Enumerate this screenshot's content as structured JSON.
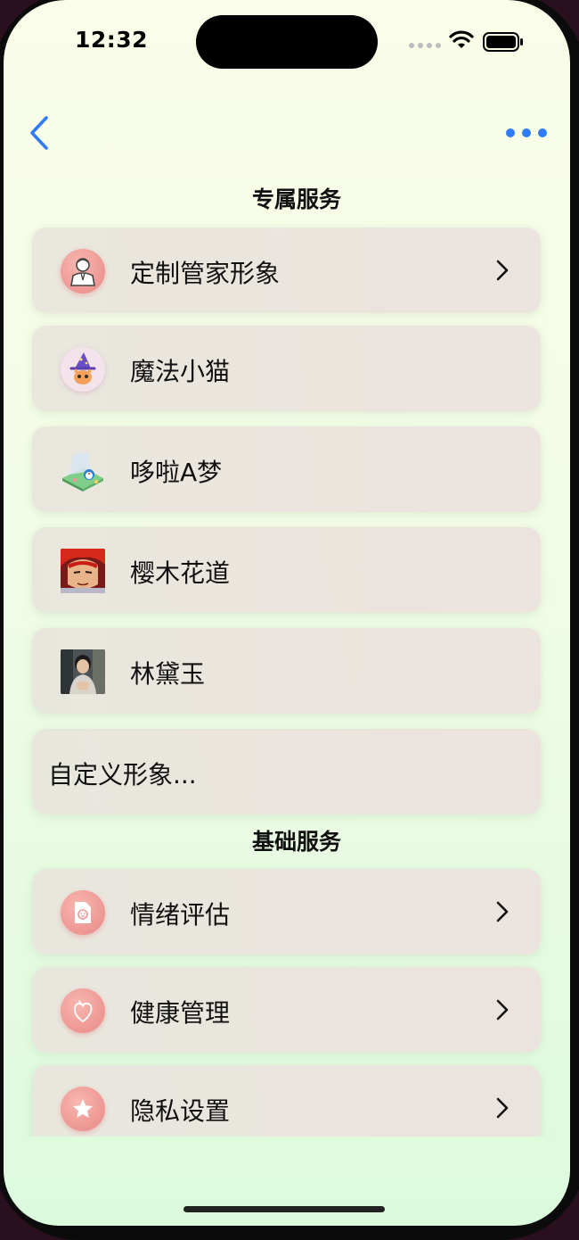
{
  "status_bar": {
    "time": "12:32"
  },
  "nav": {
    "back_icon": "chevron-left-icon",
    "more_icon": "ellipsis-icon"
  },
  "sections": {
    "exclusive": {
      "title": "专属服务",
      "items": [
        {
          "label": "定制管家形象",
          "icon": "butler-avatar-icon",
          "has_chevron": true
        },
        {
          "label": "魔法小猫",
          "icon": "magic-cat-avatar",
          "has_chevron": false
        },
        {
          "label": "哆啦A梦",
          "icon": "doraemon-avatar",
          "has_chevron": false
        },
        {
          "label": "樱木花道",
          "icon": "sakuragi-avatar",
          "has_chevron": false
        },
        {
          "label": "林黛玉",
          "icon": "lin-daiyu-avatar",
          "has_chevron": false
        },
        {
          "label": "自定义形象...",
          "icon": "",
          "has_chevron": false
        }
      ]
    },
    "basic": {
      "title": "基础服务",
      "items": [
        {
          "label": "情绪评估",
          "icon": "emotion-report-icon",
          "has_chevron": true
        },
        {
          "label": "健康管理",
          "icon": "heart-icon",
          "has_chevron": true
        },
        {
          "label": "隐私设置",
          "icon": "star-icon",
          "has_chevron": true
        }
      ]
    }
  },
  "colors": {
    "accent": "#2f7cf6",
    "background_top": "#fafde8",
    "background_bottom": "#dcfbdd",
    "icon_pink": "#ef9a96"
  }
}
